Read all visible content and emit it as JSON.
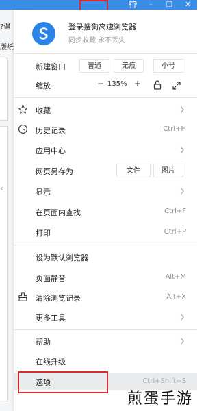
{
  "title_bar": {
    "menu_icon": "hamburger-icon",
    "skin_icon": "tshirt-icon",
    "minimize_glyph": "–",
    "restore_glyph": "❐",
    "close_glyph": "✕"
  },
  "left_strip": {
    "text_1": "?倡",
    "text_2": "版纸",
    "text_3": "‹"
  },
  "account": {
    "title": "登录搜狗高速浏览器",
    "subtitle": "同步收藏 永不丢失"
  },
  "window_row": {
    "label": "新建窗口",
    "options": [
      "普通",
      "无痕",
      "小号"
    ]
  },
  "zoom_row": {
    "label": "缩放",
    "minus": "−",
    "value": "135%",
    "plus": "+"
  },
  "menu_items": {
    "favorites": {
      "label": "收藏",
      "icon": "star-icon"
    },
    "history": {
      "label": "历史记录",
      "shortcut": "Ctrl+H",
      "icon": "clock-icon"
    },
    "app_center": {
      "label": "应用中心"
    },
    "save_page": {
      "label": "网页另存为",
      "options": [
        "文件",
        "图片"
      ]
    },
    "display": {
      "label": "显示"
    },
    "find": {
      "label": "在页面内查找",
      "shortcut": "Ctrl+F"
    },
    "print": {
      "label": "打印",
      "shortcut": "Ctrl+P"
    },
    "set_default": {
      "label": "设为默认浏览器"
    },
    "mute": {
      "label": "页面静音",
      "shortcut": "Alt+M"
    },
    "clear": {
      "label": "清除浏览记录",
      "shortcut": "Alt+X",
      "icon": "broom-icon"
    },
    "more_tools": {
      "label": "更多工具"
    },
    "help": {
      "label": "帮助"
    },
    "upgrade": {
      "label": "在线升级"
    },
    "options": {
      "label": "选项",
      "shortcut": "Ctrl+Shift+S"
    }
  },
  "watermark": "煎蛋手游",
  "colors": {
    "titlebar": "#3b8ee8",
    "highlight": "#d92b2b",
    "hover_row": "#e9eaec"
  }
}
